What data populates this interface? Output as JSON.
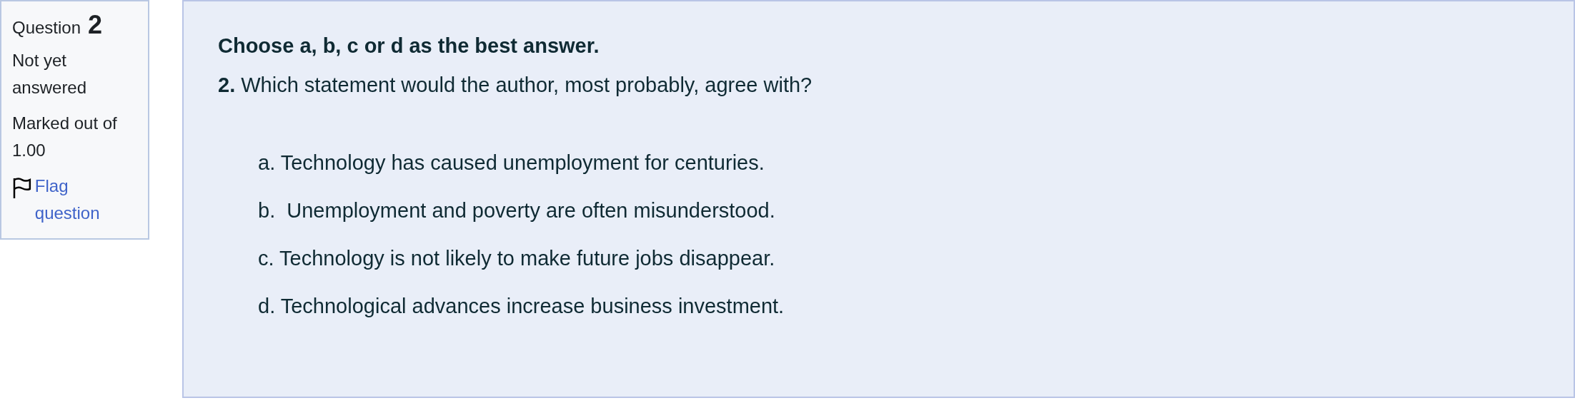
{
  "info": {
    "label": "Question",
    "number": "2",
    "status": "Not yet answered",
    "grade": "Marked out of 1.00",
    "flag": {
      "label": "Flag question",
      "flagged": false
    }
  },
  "content": {
    "instruction": "Choose a, b, c or d as the best answer.",
    "question": "**2.** Which statement would the author, most probably, agree with?",
    "options": [
      "a. Technology has caused unemployment for centuries.",
      "b.  Unemployment and poverty are often misunderstood.",
      "c. Technology is not likely to make future jobs disappear.",
      "d. Technological advances increase business investment."
    ]
  }
}
